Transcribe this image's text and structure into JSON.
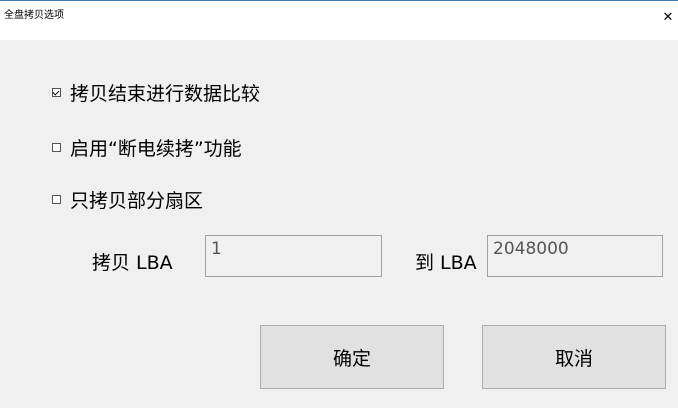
{
  "window": {
    "title": "全盘拷贝选项",
    "close_glyph": "✕"
  },
  "options": [
    {
      "label": "拷贝结束进行数据比较",
      "checked": true
    },
    {
      "label": "启用“断电续拷”功能",
      "checked": false
    },
    {
      "label": "只拷贝部分扇区",
      "checked": false
    }
  ],
  "range": {
    "from_label": "拷贝 LBA",
    "from_value": "1",
    "to_label": "到 LBA",
    "to_value": "2048000"
  },
  "buttons": {
    "ok": "确定",
    "cancel": "取消"
  }
}
